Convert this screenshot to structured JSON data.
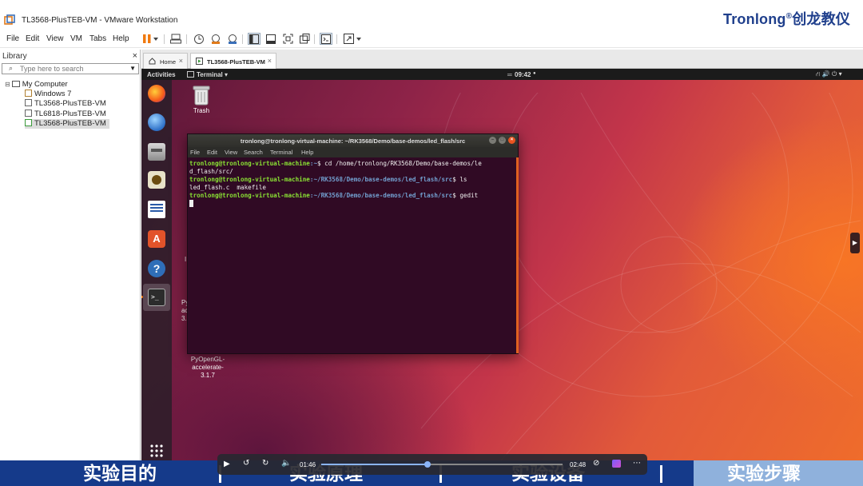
{
  "window": {
    "title": "TL3568-PlusTEB-VM - VMware Workstation",
    "brand": "Tronlong",
    "brand_mark": "®",
    "brand_cn": "创龙教仪"
  },
  "menubar": {
    "items": [
      "File",
      "Edit",
      "View",
      "VM",
      "Tabs",
      "Help"
    ]
  },
  "toolbar": {
    "icons": [
      "pause-icon",
      "dropdown-icon",
      "send-ctrl-alt-del-icon",
      "snapshot-icon",
      "revert-snapshot-icon",
      "snapshot-manager-icon",
      "show-library-icon",
      "thumbnail-icon",
      "fullscreen-icon",
      "unity-icon",
      "console-view-icon",
      "stretch-icon"
    ]
  },
  "library": {
    "title": "Library",
    "close": "×",
    "search_placeholder": "Type here to search",
    "tree": {
      "root": "My Computer",
      "items": [
        "Windows 7",
        "TL3568-PlusTEB-VM",
        "TL6818-PlusTEB-VM",
        "TL3568-PlusTEB-VM"
      ]
    }
  },
  "tabs": [
    {
      "label": "Home",
      "close": "×"
    },
    {
      "label": "TL3568-PlusTEB-VM",
      "close": "×"
    }
  ],
  "gnome": {
    "activities": "Activities",
    "app_menu": "Terminal ▾",
    "clock": "09:42",
    "status_icons": "⛙ 🔊 ⏻ ▾"
  },
  "desktop": {
    "trash_label": "Trash",
    "pyopengl_label_partial": "Py\nacce\n3.",
    "pyopengl_label": "PyOpenGL-\naccelerate-\n3.1.7",
    "stray_char": "I"
  },
  "terminal": {
    "title": "tronlong@tronlong-virtual-machine: ~/RK3568/Demo/base-demos/led_flash/src",
    "menu": [
      "File",
      "Edit",
      "View",
      "Search",
      "Terminal",
      "Help"
    ],
    "lines": [
      {
        "user": "tronlong@tronlong-virtual-machine",
        "path": ":~",
        "cmd": "$ cd /home/tronlong/RK3568/Demo/base-demos/le"
      },
      {
        "output": "d_flash/src/"
      },
      {
        "user": "tronlong@tronlong-virtual-machine",
        "path": ":~/RK3568/Demo/base-demos/led_flash/src",
        "cmd": "$ ls"
      },
      {
        "output": "led_flash.c  makefile"
      },
      {
        "user": "tronlong@tronlong-virtual-machine",
        "path": ":~/RK3568/Demo/base-demos/led_flash/src",
        "cmd": "$ gedit"
      }
    ]
  },
  "player": {
    "current_time": "01:46",
    "total_time": "02:48",
    "progress": 0.44
  },
  "bottom_nav": {
    "items": [
      "实验目的",
      "实验原理",
      "实验设备",
      "实验步骤"
    ]
  }
}
